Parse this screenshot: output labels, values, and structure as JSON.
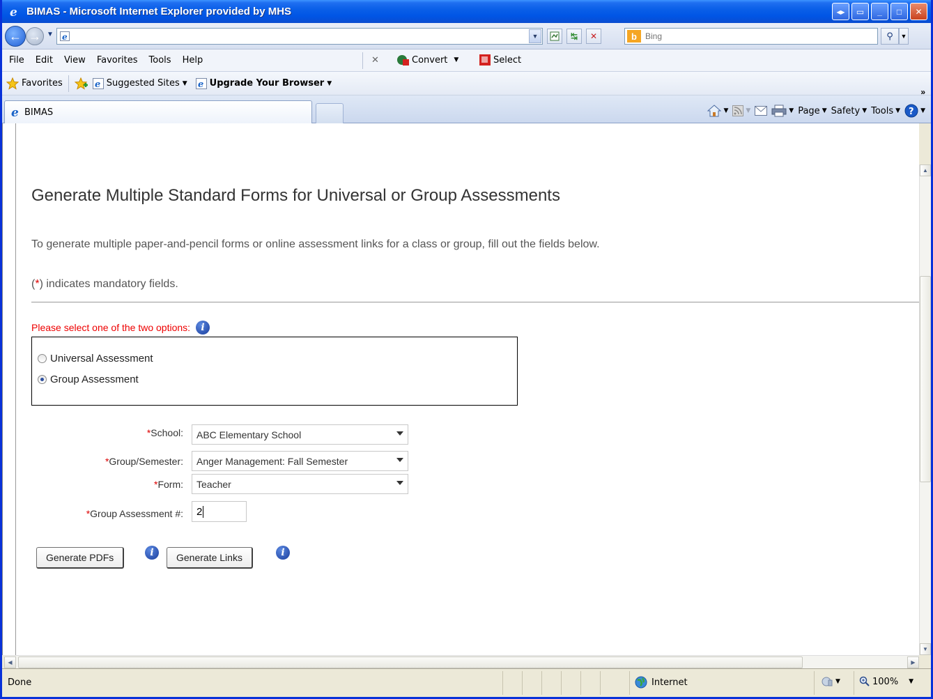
{
  "window": {
    "title": "BIMAS - Microsoft Internet Explorer provided by MHS"
  },
  "address": {
    "value": ""
  },
  "search": {
    "placeholder": "Bing",
    "engine": "b"
  },
  "menu": {
    "items": [
      "File",
      "Edit",
      "View",
      "Favorites",
      "Tools",
      "Help"
    ],
    "convert_label": "Convert",
    "select_label": "Select"
  },
  "favorites": {
    "label": "Favorites",
    "suggested": "Suggested Sites",
    "upgrade": "Upgrade Your Browser"
  },
  "tab": {
    "label": "BIMAS"
  },
  "commandbar": {
    "page": "Page",
    "safety": "Safety",
    "tools": "Tools"
  },
  "page": {
    "title": "Generate Multiple Standard Forms for Universal or Group Assessments",
    "intro": "To generate multiple paper-and-pencil forms or online assessment links for a class or group, fill out the fields below.",
    "mandatory_star": "*",
    "mandatory_text": ") indicates mandatory fields.",
    "mandatory_open": "(",
    "select_prompt": "Please select one of the two options:",
    "options": [
      {
        "label": "Universal Assessment",
        "checked": false
      },
      {
        "label": "Group Assessment",
        "checked": true
      }
    ],
    "fields": {
      "school": {
        "label": "School:",
        "value": "ABC Elementary School"
      },
      "group": {
        "label": "Group/Semester:",
        "value": "Anger Management: Fall Semester"
      },
      "form": {
        "label": "Form:",
        "value": "Teacher"
      },
      "assessment": {
        "label": "Group Assessment #:",
        "value": "2"
      }
    },
    "buttons": {
      "pdfs": "Generate PDFs",
      "links": "Generate Links"
    }
  },
  "status": {
    "text": "Done",
    "zone": "Internet",
    "zoom": "100%"
  },
  "colors": {
    "title_blue": "#0055e5",
    "required_red": "#dd0000",
    "info_blue": "#1a3d9c"
  }
}
